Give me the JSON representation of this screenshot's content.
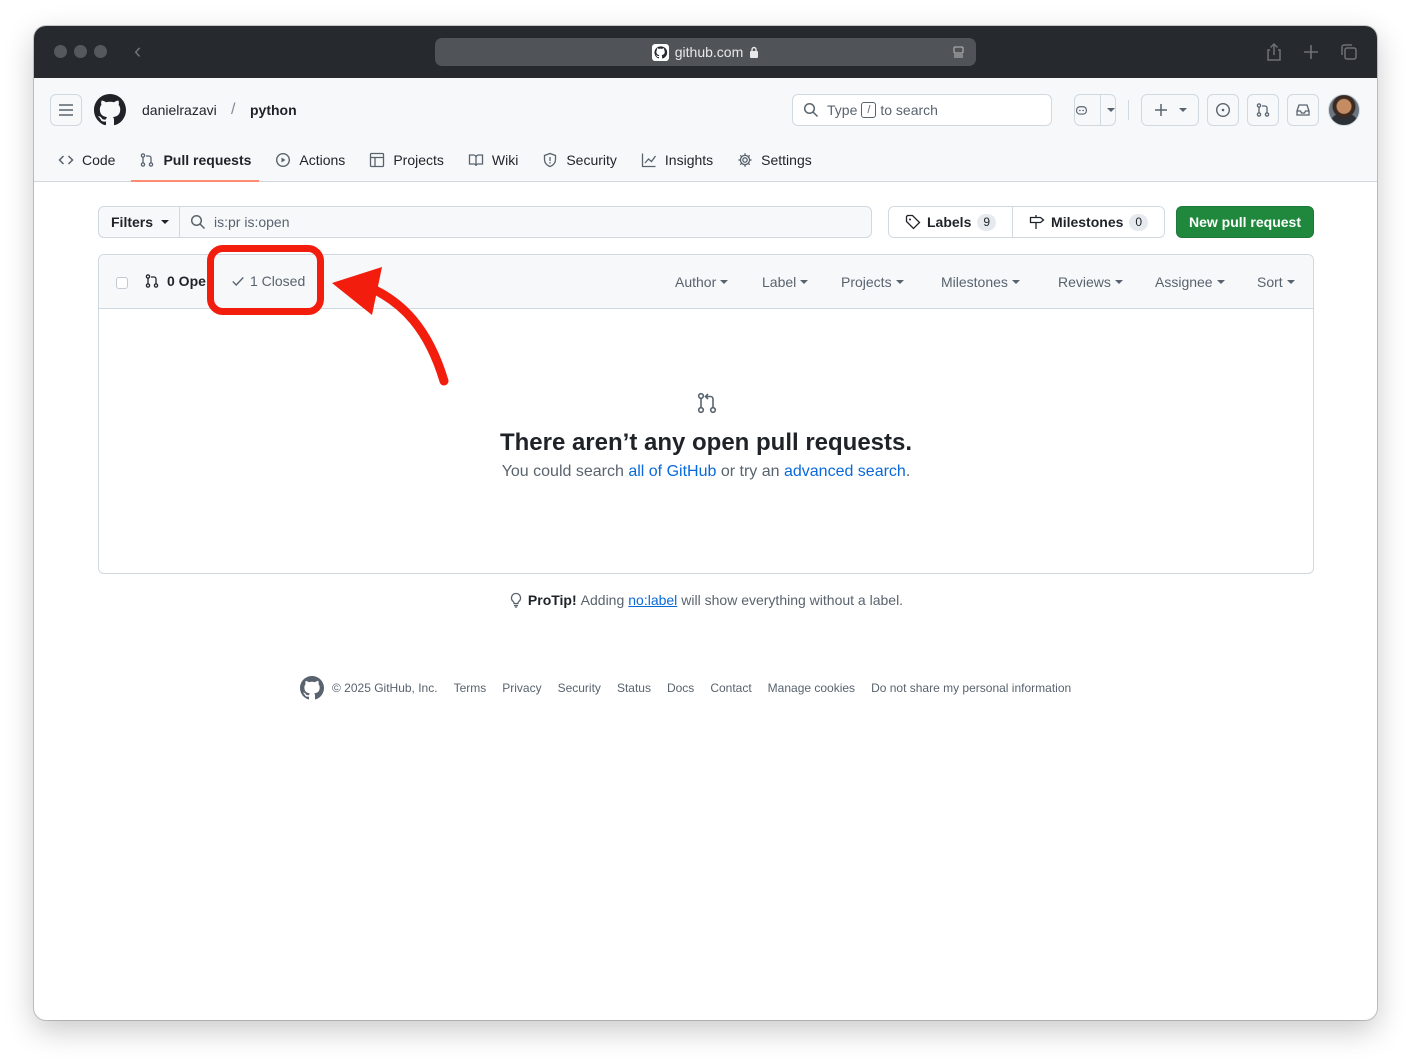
{
  "browser": {
    "url": "github.com"
  },
  "header": {
    "owner": "danielrazavi",
    "separator": "/",
    "repo": "python",
    "search_prefix": "Type",
    "search_key": "/",
    "search_suffix": "to search"
  },
  "tabs": [
    {
      "label": "Code",
      "icon": "code-icon"
    },
    {
      "label": "Pull requests",
      "icon": "git-pull-request-icon"
    },
    {
      "label": "Actions",
      "icon": "play-icon"
    },
    {
      "label": "Projects",
      "icon": "table-icon"
    },
    {
      "label": "Wiki",
      "icon": "book-icon"
    },
    {
      "label": "Security",
      "icon": "shield-icon"
    },
    {
      "label": "Insights",
      "icon": "graph-icon"
    },
    {
      "label": "Settings",
      "icon": "gear-icon"
    }
  ],
  "active_tab": "Pull requests",
  "toolbar": {
    "filters_label": "Filters",
    "query": "is:pr is:open",
    "labels_label": "Labels",
    "labels_count": "9",
    "milestones_label": "Milestones",
    "milestones_count": "0",
    "new_pr_label": "New pull request"
  },
  "list_header": {
    "open_label": "0 Ope",
    "closed_label": "1 Closed",
    "filters": [
      "Author",
      "Label",
      "Projects",
      "Milestones",
      "Reviews",
      "Assignee",
      "Sort"
    ]
  },
  "blankslate": {
    "title": "There aren’t any open pull requests.",
    "text_1": "You could search",
    "link_1": "all of GitHub",
    "text_2": "or try an",
    "link_2": "advanced search",
    "text_3": "."
  },
  "protip": {
    "strong": "ProTip!",
    "text_1": "Adding",
    "link": "no:label",
    "text_2": "will show everything without a label."
  },
  "footer": {
    "copyright": "© 2025 GitHub, Inc.",
    "links": [
      "Terms",
      "Privacy",
      "Security",
      "Status",
      "Docs",
      "Contact",
      "Manage cookies",
      "Do not share my personal information"
    ]
  },
  "colors": {
    "primary_button": "#1f883d",
    "link": "#0969da",
    "annotation": "#f31d0d",
    "active_tab_underline": "#fd8c73"
  }
}
